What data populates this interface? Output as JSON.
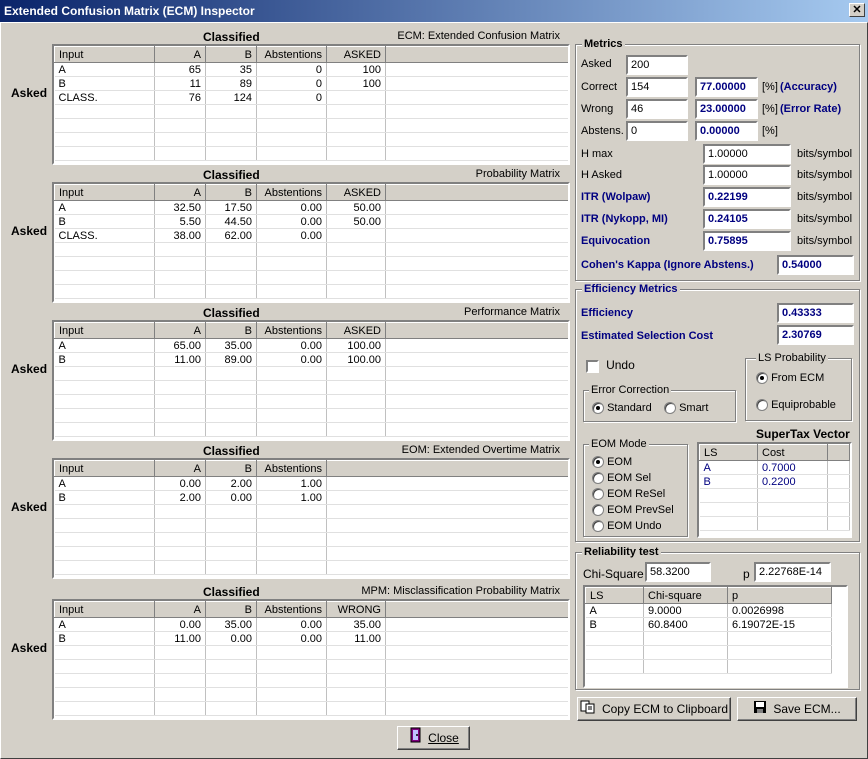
{
  "window": {
    "title": "Extended Confusion Matrix (ECM) Inspector",
    "close_glyph": "✕"
  },
  "common": {
    "asked": "Asked",
    "classified": "Classified"
  },
  "matrices": [
    {
      "title": "ECM: Extended Confusion Matrix",
      "headers": [
        "Input",
        "A",
        "B",
        "Abstentions",
        "ASKED"
      ],
      "rows": [
        [
          "A",
          "65",
          "35",
          "0",
          "100"
        ],
        [
          "B",
          "11",
          "89",
          "0",
          "100"
        ],
        [
          "CLASS.",
          "76",
          "124",
          "0",
          ""
        ]
      ]
    },
    {
      "title": "Probability Matrix",
      "headers": [
        "Input",
        "A",
        "B",
        "Abstentions",
        "ASKED"
      ],
      "rows": [
        [
          "A",
          "32.50",
          "17.50",
          "0.00",
          "50.00"
        ],
        [
          "B",
          "5.50",
          "44.50",
          "0.00",
          "50.00"
        ],
        [
          "CLASS.",
          "38.00",
          "62.00",
          "0.00",
          ""
        ]
      ]
    },
    {
      "title": "Performance Matrix",
      "headers": [
        "Input",
        "A",
        "B",
        "Abstentions",
        "ASKED"
      ],
      "rows": [
        [
          "A",
          "65.00",
          "35.00",
          "0.00",
          "100.00"
        ],
        [
          "B",
          "11.00",
          "89.00",
          "0.00",
          "100.00"
        ]
      ]
    },
    {
      "title": "EOM: Extended Overtime Matrix",
      "headers": [
        "Input",
        "A",
        "B",
        "Abstentions"
      ],
      "rows": [
        [
          "A",
          "0.00",
          "2.00",
          "1.00"
        ],
        [
          "B",
          "2.00",
          "0.00",
          "1.00"
        ]
      ]
    },
    {
      "title": "MPM: Misclassification Probability Matrix",
      "headers": [
        "Input",
        "A",
        "B",
        "Abstentions",
        "WRONG"
      ],
      "rows": [
        [
          "A",
          "0.00",
          "35.00",
          "0.00",
          "35.00"
        ],
        [
          "B",
          "11.00",
          "0.00",
          "0.00",
          "11.00"
        ]
      ]
    }
  ],
  "metrics": {
    "group_label": "Metrics",
    "asked_label": "Asked",
    "asked_value": "200",
    "correct_label": "Correct",
    "correct_value": "154",
    "accuracy_value": "77.00000",
    "accuracy_label": "(Accuracy)",
    "wrong_label": "Wrong",
    "wrong_value": "46",
    "error_value": "23.00000",
    "error_label": "(Error Rate)",
    "abstens_label": "Abstens.",
    "abstens_value": "0",
    "abstens_pct": "0.00000",
    "pct": "[%]",
    "hmax_label": "H max",
    "hmax_value": "1.00000",
    "hasked_label": "H Asked",
    "hasked_value": "1.00000",
    "itr_wolpaw_label": "ITR (Wolpaw)",
    "itr_wolpaw_value": "0.22199",
    "itr_nykopp_label": "ITR (Nykopp, MI)",
    "itr_nykopp_value": "0.24105",
    "equivocation_label": "Equivocation",
    "equivocation_value": "0.75895",
    "unit": "bits/symbol",
    "kappa_label": "Cohen's Kappa (Ignore Abstens.)",
    "kappa_value": "0.54000"
  },
  "efficiency": {
    "group_label": "Efficiency Metrics",
    "efficiency_label": "Efficiency",
    "efficiency_value": "0.43333",
    "cost_label": "Estimated Selection Cost",
    "cost_value": "2.30769",
    "undo_label": "Undo",
    "error_correction_label": "Error Correction",
    "standard_label": "Standard",
    "smart_label": "Smart",
    "ls_prob_label": "LS Probability",
    "from_ecm_label": "From ECM",
    "equiprobable_label": "Equiprobable",
    "eom_mode_label": "EOM Mode",
    "eom_modes": [
      "EOM",
      "EOM Sel",
      "EOM ReSel",
      "EOM PrevSel",
      "EOM Undo"
    ],
    "supertax_label": "SuperTax Vector",
    "supertax_headers": [
      "LS",
      "Cost"
    ],
    "supertax_rows": [
      [
        "A",
        "0.7000"
      ],
      [
        "B",
        "0.2200"
      ]
    ]
  },
  "reliability": {
    "group_label": "Reliability test",
    "chisq_label": "Chi-Square",
    "chisq_value": "58.3200",
    "p_label": "p",
    "p_value": "2.22768E-14",
    "headers": [
      "LS",
      "Chi-square",
      "p"
    ],
    "rows": [
      [
        "A",
        "9.0000",
        "0.0026998"
      ],
      [
        "B",
        "60.8400",
        "6.19072E-15"
      ]
    ]
  },
  "buttons": {
    "copy": "Copy ECM to Clipboard",
    "save": "Save ECM...",
    "close": "Close"
  }
}
